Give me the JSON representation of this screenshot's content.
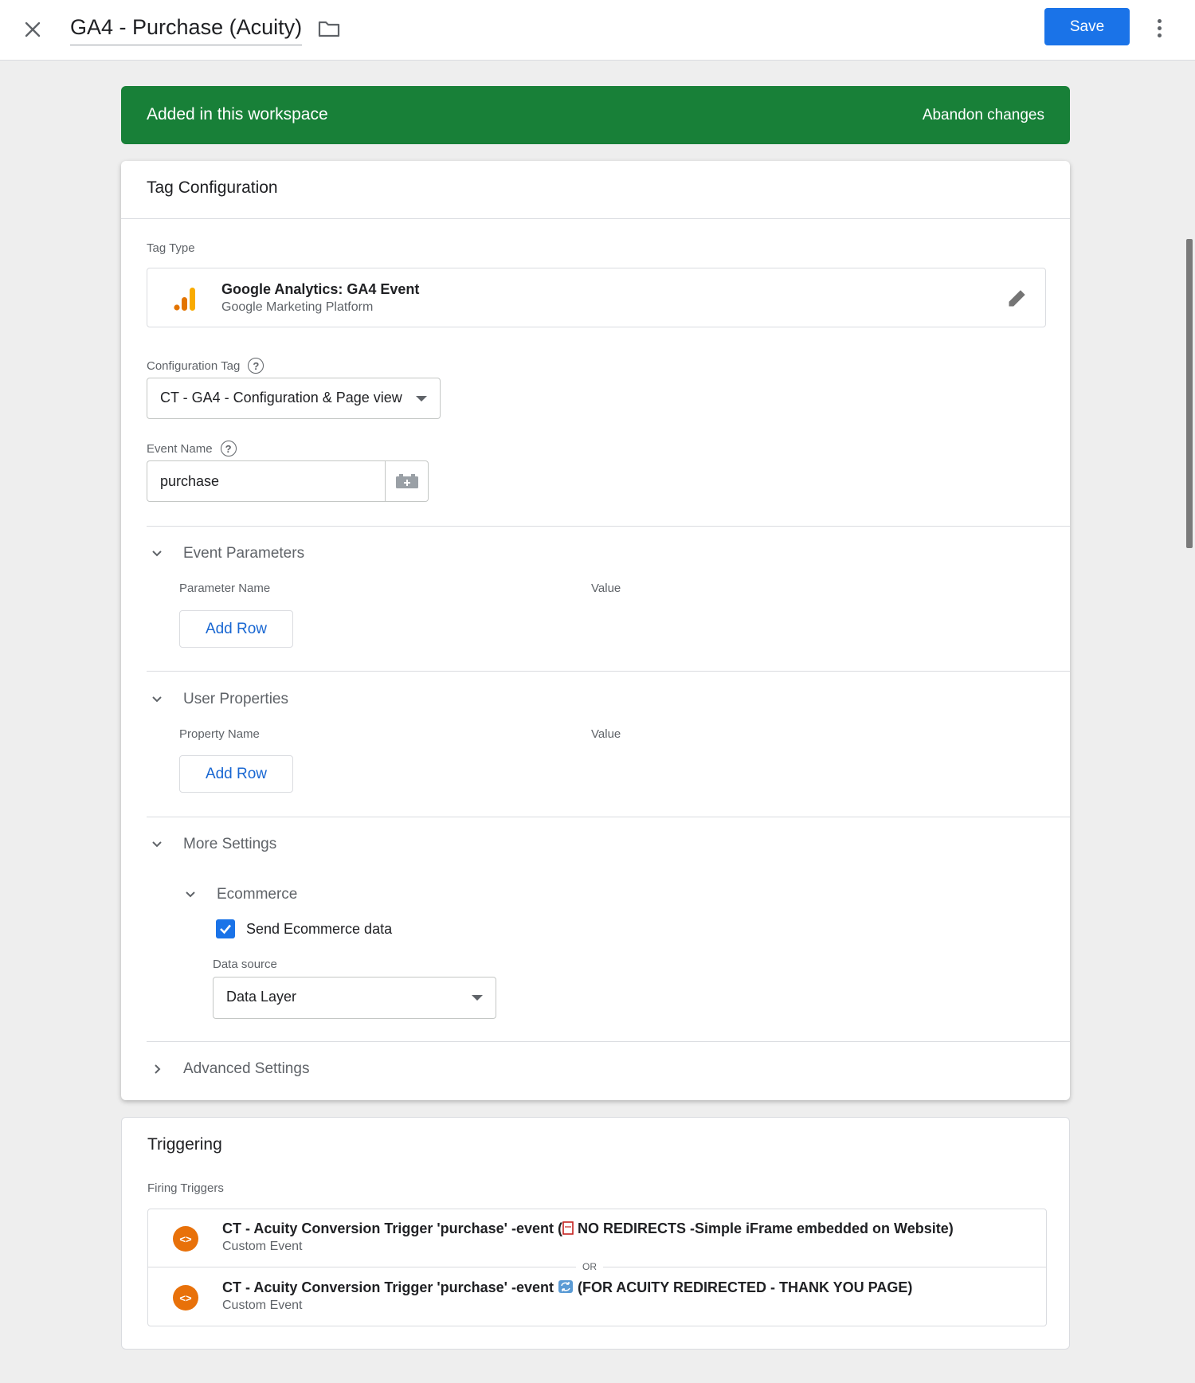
{
  "header": {
    "title": "GA4 - Purchase (Acuity)",
    "save_label": "Save"
  },
  "banner": {
    "text": "Added in this workspace",
    "action": "Abandon changes",
    "color": "#188038"
  },
  "tag_config": {
    "title": "Tag Configuration",
    "tag_type_label": "Tag Type",
    "tag_type": {
      "name": "Google Analytics: GA4 Event",
      "provider": "Google Marketing Platform",
      "icon": "google-analytics-icon"
    },
    "config_tag_label": "Configuration Tag",
    "config_tag_value": "CT - GA4 - Configuration & Page view",
    "event_name_label": "Event Name",
    "event_name_value": "purchase",
    "event_parameters": {
      "title": "Event Parameters",
      "col_name": "Parameter Name",
      "col_value": "Value",
      "add_row": "Add Row"
    },
    "user_properties": {
      "title": "User Properties",
      "col_name": "Property Name",
      "col_value": "Value",
      "add_row": "Add Row"
    },
    "more_settings": {
      "title": "More Settings",
      "ecommerce": {
        "title": "Ecommerce",
        "send_label": "Send Ecommerce data",
        "send_checked": true,
        "data_source_label": "Data source",
        "data_source_value": "Data Layer"
      }
    },
    "advanced_settings": "Advanced Settings"
  },
  "triggering": {
    "title": "Triggering",
    "firing_label": "Firing Triggers",
    "or_label": "OR",
    "triggers": [
      {
        "name_prefix": "CT - Acuity Conversion Trigger 'purchase' -event (",
        "name_suffix": " NO REDIRECTS -Simple iFrame embedded on Website)",
        "type": "Custom Event"
      },
      {
        "name_prefix": "CT - Acuity Conversion Trigger 'purchase' -event ",
        "name_suffix": " (FOR ACUITY REDIRECTED - THANK YOU PAGE)",
        "type": "Custom Event"
      }
    ]
  },
  "colors": {
    "primary": "#1a73e8",
    "success": "#188038",
    "trigger_icon": "#e8710a"
  }
}
